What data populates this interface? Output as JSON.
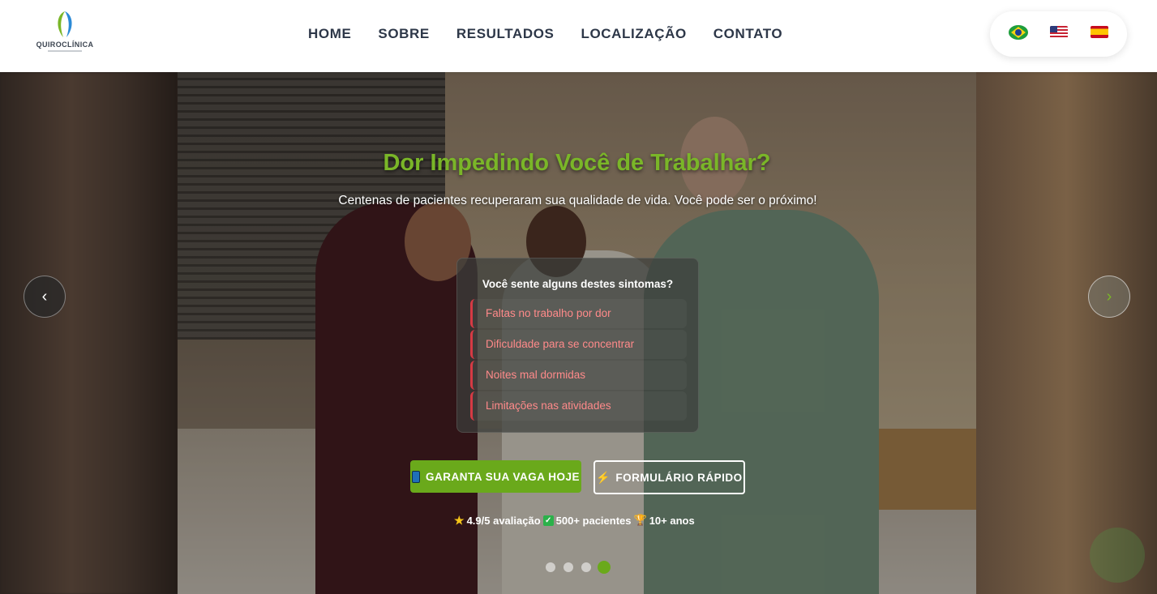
{
  "header": {
    "logo": {
      "text": "QUIROCLÍNICA"
    },
    "nav": [
      {
        "label": "HOME"
      },
      {
        "label": "SOBRE"
      },
      {
        "label": "RESULTADOS"
      },
      {
        "label": "LOCALIZAÇÃO"
      },
      {
        "label": "CONTATO"
      }
    ],
    "languages": [
      {
        "icon": "flag-brazil-icon"
      },
      {
        "icon": "flag-usa-icon"
      },
      {
        "icon": "flag-spain-icon"
      }
    ]
  },
  "hero": {
    "title": "Dor Impedindo Você de Trabalhar?",
    "subtitle": "Centenas de pacientes recuperaram sua qualidade de vida. Você pode ser o próximo!",
    "symptoms": {
      "title": "Você sente alguns destes sintomas?",
      "items": [
        {
          "label": "Faltas no trabalho por dor"
        },
        {
          "label": "Dificuldade para se concentrar"
        },
        {
          "label": "Noites mal dormidas"
        },
        {
          "label": "Limitações nas atividades"
        }
      ]
    },
    "primary_button": {
      "label": "GARANTA SUA VAGA HOJE",
      "icon": "phone-icon"
    },
    "secondary_button": {
      "label": "FORMULÁRIO RÁPIDO",
      "icon": "lightning-icon"
    },
    "stats": {
      "rating": "4.9/5 avaliação",
      "patients": "500+ pacientes",
      "years": "10+ anos"
    },
    "carousel": {
      "slide_count": 4,
      "active_slide": 4
    },
    "prev_arrow": "‹",
    "next_arrow": "›"
  },
  "colors": {
    "accent_green": "#6aa91b",
    "title_green": "#7ab628",
    "symptom_red": "#d63a44",
    "symptom_text": "#ff8a8a",
    "nav_text": "#2d3748"
  }
}
